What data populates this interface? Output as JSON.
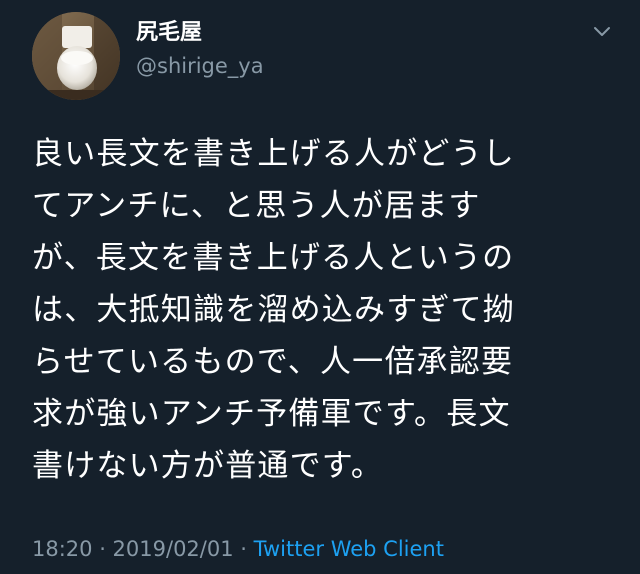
{
  "user": {
    "display_name": "尻毛屋",
    "handle": "@shirige_ya",
    "avatar_icon": "toilet-photo-avatar"
  },
  "menu": {
    "icon": "chevron-down-icon"
  },
  "tweet": {
    "lines": [
      "良い長文を書き上げる人がどうし",
      "てアンチに、と思う人が居ます",
      "が、長文を書き上げる人というの",
      "は、大抵知識を溜め込みすぎて拗",
      "らせているもので、人一倍承認要",
      "求が強いアンチ予備軍です。長文",
      "書けない方が普通です。"
    ]
  },
  "meta": {
    "time": "18:20 · 2019/02/01",
    "separator": "·",
    "source": "Twitter Web Client"
  },
  "colors": {
    "background": "#15202b",
    "text": "#ffffff",
    "secondary": "#8899a6",
    "link": "#1da1f2"
  }
}
